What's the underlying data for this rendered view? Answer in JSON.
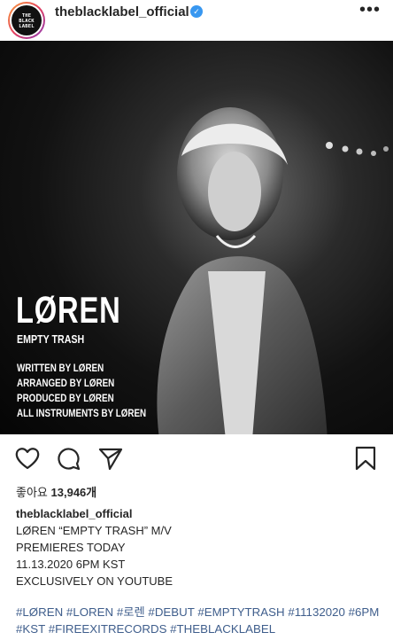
{
  "header": {
    "avatar_lines": [
      "THE",
      "BLACK",
      "LABEL"
    ],
    "username": "theblacklabel_official",
    "verified_glyph": "✓",
    "more_glyph": "•••"
  },
  "post_image": {
    "title": "LØREN",
    "subtitle": "EMPTY TRASH",
    "credits": [
      "WRITTEN BY LØREN",
      "ARRANGED BY LØREN",
      "PRODUCED BY LØREN",
      "ALL INSTRUMENTS BY LØREN"
    ]
  },
  "actions": {
    "like_icon": "heart-icon",
    "comment_icon": "comment-icon",
    "share_icon": "send-icon",
    "save_icon": "bookmark-icon"
  },
  "likes": {
    "label": "좋아요",
    "count": "13,946개"
  },
  "caption": {
    "username": "theblacklabel_official",
    "lines": [
      "LØREN “EMPTY TRASH” M/V",
      "PREMIERES TODAY",
      "11.13.2020 6PM KST",
      "EXCLUSIVELY ON YOUTUBE"
    ],
    "hashtags": [
      "#LØREN",
      "#LOREN",
      "#로렌",
      "#DEBUT",
      "#EMPTYTRASH",
      "#11132020",
      "#6PM",
      "#KST",
      "#FIREEXITRECORDS",
      "#THEBLACKLABEL"
    ]
  },
  "colors": {
    "text": "#262626",
    "link": "#3f5e8c",
    "verified": "#3897f0"
  }
}
